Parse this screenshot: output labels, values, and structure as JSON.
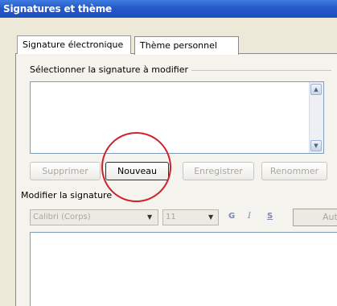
{
  "window": {
    "title": "Signatures et thème"
  },
  "tabs": [
    {
      "label": "Signature électronique"
    },
    {
      "label": "Thème personnel"
    }
  ],
  "select_group": {
    "label": "Sélectionner la signature à modifier"
  },
  "buttons": {
    "delete": "Supprimer",
    "new": "Nouveau",
    "save": "Enregistrer",
    "rename": "Renommer"
  },
  "edit_group": {
    "label": "Modifier la signature"
  },
  "toolbar": {
    "font": "Calibri (Corps)",
    "size": "11",
    "bold": "G",
    "italic": "I",
    "underline": "S",
    "align": "Aut"
  },
  "colors": {
    "highlight": "#d31f2a",
    "titlebar": "#2559c8"
  }
}
